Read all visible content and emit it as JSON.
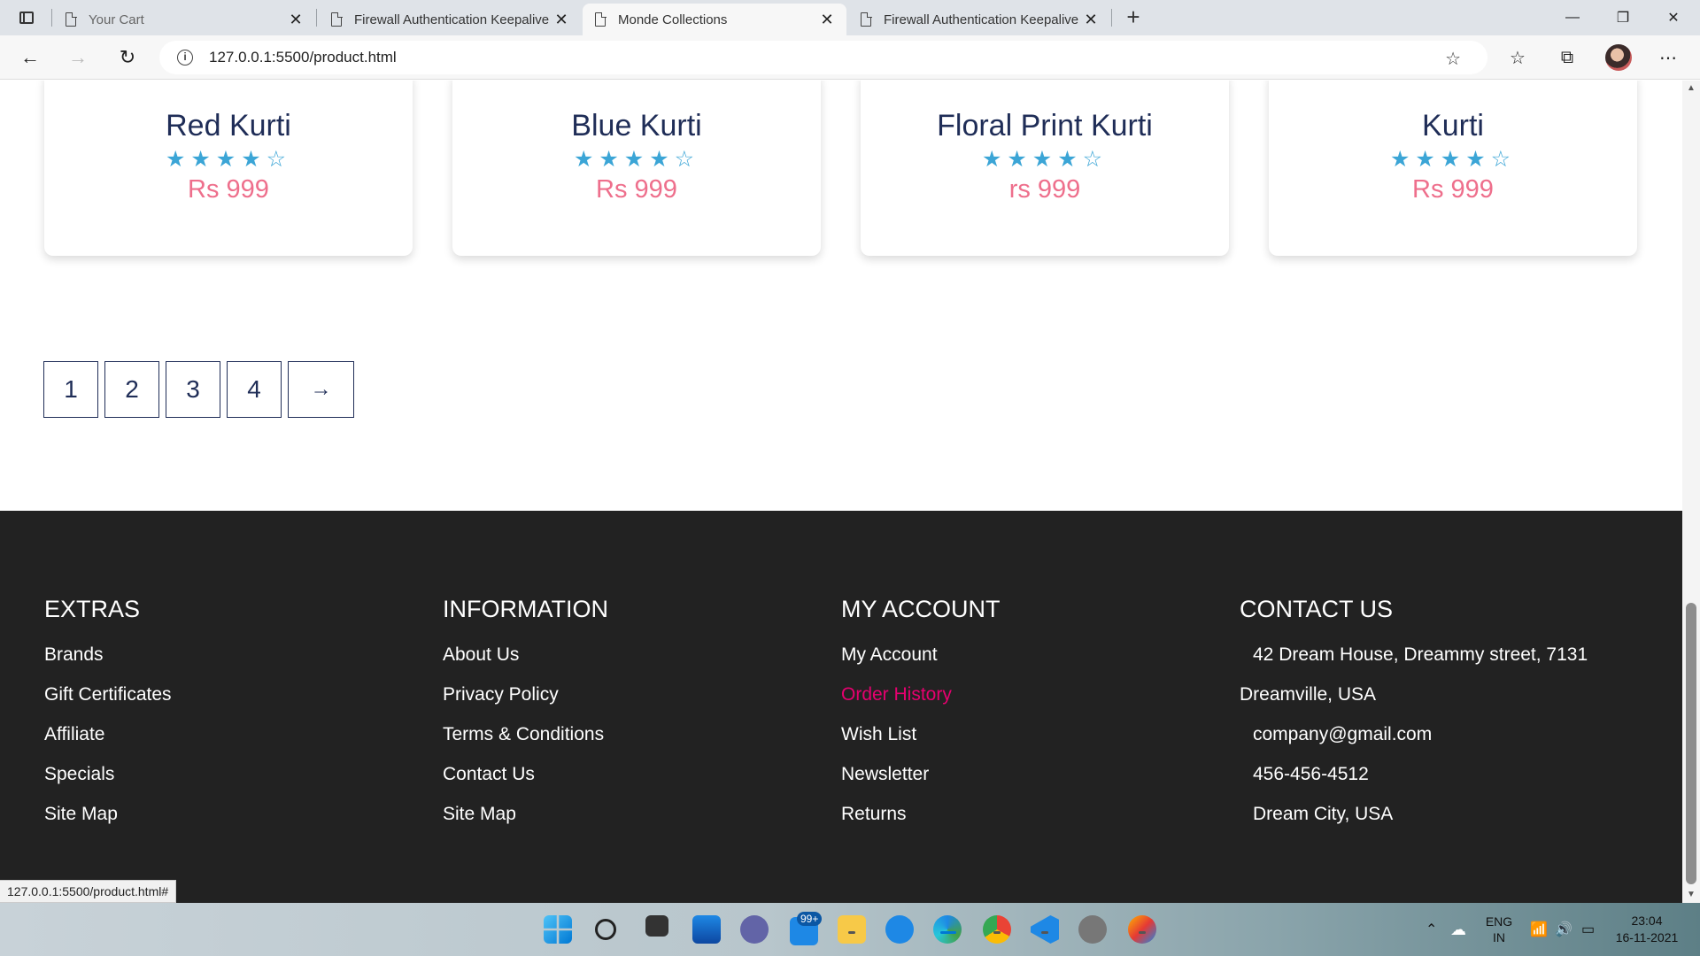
{
  "browser": {
    "tabs": [
      {
        "title": "Your Cart",
        "active": false,
        "dim": true
      },
      {
        "title": "Firewall Authentication Keepalive",
        "active": false,
        "dim": false
      },
      {
        "title": "Monde Collections",
        "active": true,
        "dim": false
      },
      {
        "title": "Firewall Authentication Keepalive",
        "active": false,
        "dim": false
      }
    ],
    "new_tab": "+",
    "url": "127.0.0.1:5500/product.html",
    "status_url": "127.0.0.1:5500/product.html#"
  },
  "products": [
    {
      "name": "Red Kurti",
      "stars": "★★★★☆",
      "rating": 4,
      "price": "Rs 999"
    },
    {
      "name": "Blue Kurti",
      "stars": "★★★★☆",
      "rating": 4,
      "price": "Rs 999"
    },
    {
      "name": "Floral Print Kurti",
      "stars": "★★★★☆",
      "rating": 4,
      "price": "rs 999"
    },
    {
      "name": "Kurti",
      "stars": "★★★★☆",
      "rating": 4,
      "price": "Rs 999"
    }
  ],
  "pagination": {
    "pages": [
      "1",
      "2",
      "3",
      "4"
    ],
    "next": "→"
  },
  "footer": {
    "columns": [
      {
        "heading": "EXTRAS",
        "links": [
          "Brands",
          "Gift Certificates",
          "Affiliate",
          "Specials",
          "Site Map"
        ]
      },
      {
        "heading": "INFORMATION",
        "links": [
          "About Us",
          "Privacy Policy",
          "Terms & Conditions",
          "Contact Us",
          "Site Map"
        ]
      },
      {
        "heading": "MY ACCOUNT",
        "links": [
          "My Account",
          "Order History",
          "Wish List",
          "Newsletter",
          "Returns"
        ]
      },
      {
        "heading": "CONTACT US",
        "links": [
          "42 Dream House, Dreammy street, 7131",
          "Dreamville, USA",
          "company@gmail.com",
          "456-456-4512",
          "Dream City, USA"
        ]
      }
    ]
  },
  "taskbar": {
    "mail_badge": "99+",
    "language": "ENG",
    "region": "IN",
    "time": "23:04",
    "date": "16-11-2021"
  },
  "colors": {
    "accent_pink": "#ee6f8c",
    "active_link": "#e6006f",
    "navy": "#1f2d57",
    "star": "#3ba5d6",
    "footer_bg": "#222222",
    "highlight_border": "#ef8a62"
  }
}
